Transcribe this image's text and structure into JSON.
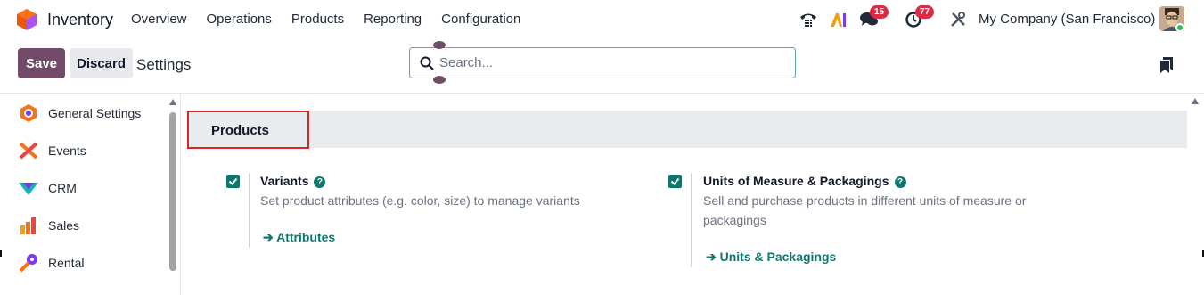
{
  "navbar": {
    "app_name": "Inventory",
    "menu": [
      "Overview",
      "Operations",
      "Products",
      "Reporting",
      "Configuration"
    ],
    "messages_badge": "15",
    "activities_badge": "77",
    "company": "My Company (San Francisco)",
    "icons": [
      "phone-icon",
      "ai-icon",
      "chat-icon",
      "activity-clock-icon",
      "tools-icon"
    ]
  },
  "controls": {
    "save_label": "Save",
    "discard_label": "Discard",
    "page_title": "Settings",
    "search_placeholder": "Search..."
  },
  "sidebar": {
    "items": [
      {
        "label": "General Settings",
        "icon": "odoo-settings-icon"
      },
      {
        "label": "Events",
        "icon": "events-icon"
      },
      {
        "label": "CRM",
        "icon": "crm-icon"
      },
      {
        "label": "Sales",
        "icon": "sales-icon"
      },
      {
        "label": "Rental",
        "icon": "rental-icon"
      }
    ]
  },
  "section": {
    "title": "Products",
    "settings": [
      {
        "title": "Variants",
        "checked": true,
        "description": "Set product attributes (e.g. color, size) to manage variants",
        "link": "Attributes"
      },
      {
        "title": "Units of Measure & Packagings",
        "checked": true,
        "description_line1": "Sell and purchase products in different units of measure or",
        "description_line2": "packagings",
        "link": "Units & Packagings"
      }
    ]
  },
  "colors": {
    "primary": "#714b67",
    "accent": "#0f766e",
    "badge": "#dc2b45",
    "highlight": "#e02424"
  }
}
